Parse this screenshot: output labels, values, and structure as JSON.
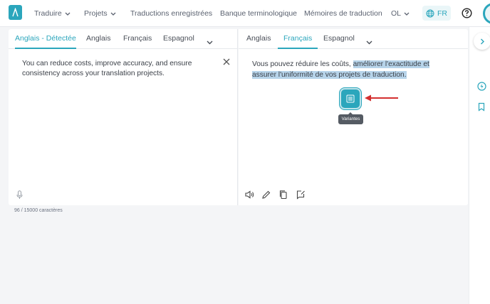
{
  "nav": {
    "items": [
      {
        "label": "Traduire",
        "has_dropdown": true
      },
      {
        "label": "Projets",
        "has_dropdown": true
      },
      {
        "label": "Traductions enregistrées",
        "has_dropdown": false
      },
      {
        "label": "Banque terminologique",
        "has_dropdown": false
      },
      {
        "label": "Mémoires de traduction",
        "has_dropdown": false
      },
      {
        "label": "OL",
        "has_dropdown": true
      }
    ],
    "ui_language": "FR",
    "icons": {
      "logo": "app-logo-icon",
      "globe": "globe-icon",
      "help": "help-icon",
      "avatar": "user-avatar"
    }
  },
  "source": {
    "tabs": [
      "Anglais - Détectée",
      "Anglais",
      "Français",
      "Espagnol"
    ],
    "active_tab": "Anglais - Détectée",
    "text": "You can reduce costs, improve accuracy, and ensure consistency across your translation projects.",
    "char_count": "96 / 15000 caractères"
  },
  "target": {
    "tabs": [
      "Anglais",
      "Français",
      "Espagnol"
    ],
    "active_tab": "Français",
    "text_plain": "Vous pouvez réduire les coûts, ",
    "text_highlighted": "améliorer l'exactitude et assurer l'uniformité de vos projets de traduction.",
    "variants_tooltip": "Variantes",
    "tools": [
      "speaker-icon",
      "edit-icon",
      "copy-icon",
      "feedback-icon"
    ]
  },
  "colors": {
    "accent": "#2ba6bc",
    "highlight": "#b7d4ea",
    "annotation_arrow": "#d32f2f"
  }
}
